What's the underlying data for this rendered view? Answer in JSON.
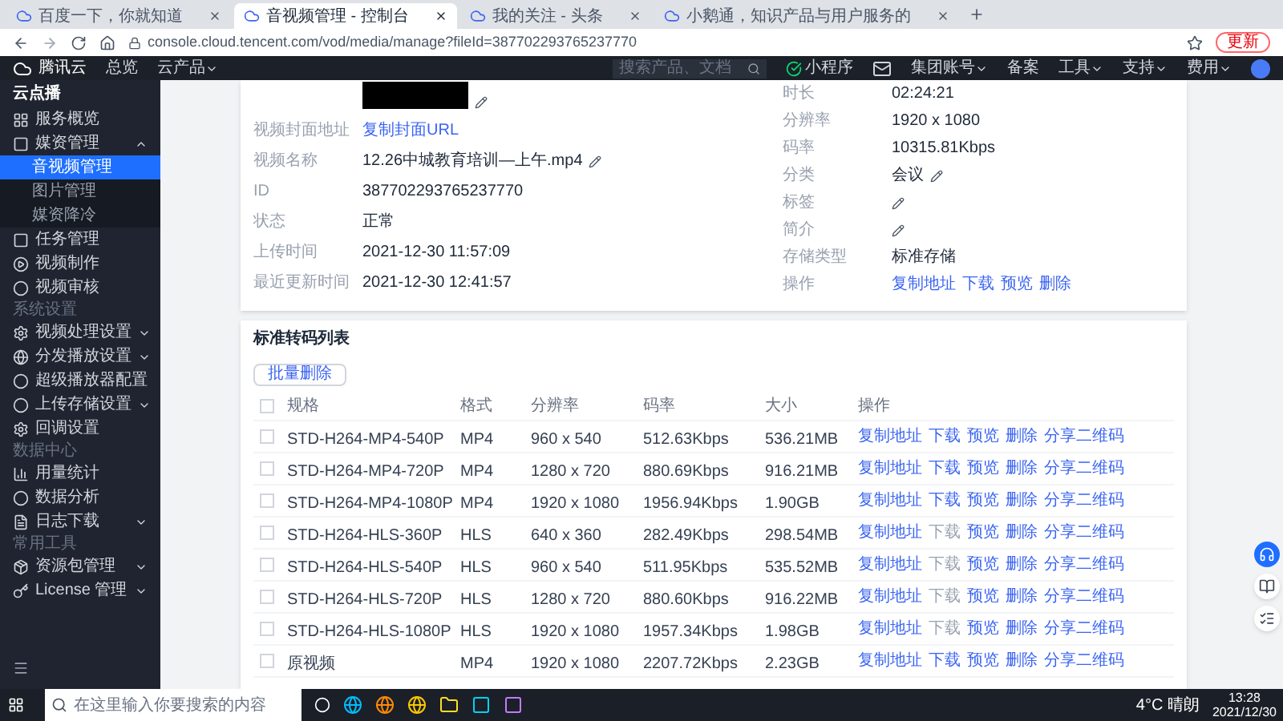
{
  "browser": {
    "tabs": [
      {
        "title": "百度一下，你就知道",
        "selected": false
      },
      {
        "title": "音视频管理 - 控制台",
        "selected": true
      },
      {
        "title": "我的关注 - 头条",
        "selected": false
      },
      {
        "title": "小鹅通，知识产品与用户服务的",
        "selected": false
      }
    ],
    "url": "console.cloud.tencent.com/vod/media/manage?fileId=387702293765237770",
    "update_button": "更新"
  },
  "topnav": {
    "logo": "腾讯云",
    "left": [
      {
        "label": "总览",
        "dropdown": false
      },
      {
        "label": "云产品",
        "dropdown": true
      }
    ],
    "search_placeholder": "搜索产品、文档",
    "right": [
      {
        "label": "小程序",
        "kind": "mini"
      },
      {
        "kind": "mail"
      },
      {
        "label": "集团账号",
        "kind": "menu"
      },
      {
        "label": "备案",
        "kind": "link"
      },
      {
        "label": "工具",
        "kind": "menu"
      },
      {
        "label": "支持",
        "kind": "menu"
      },
      {
        "label": "费用",
        "kind": "menu"
      }
    ]
  },
  "sidebar": {
    "title": "云点播",
    "groups": [
      {
        "items": [
          {
            "label": "服务概览"
          },
          {
            "label": "媒资管理",
            "expanded": true,
            "children": [
              {
                "label": "音视频管理",
                "selected": true
              },
              {
                "label": "图片管理",
                "selected": false
              },
              {
                "label": "媒资降冷",
                "selected": false
              }
            ]
          },
          {
            "label": "任务管理"
          },
          {
            "label": "视频制作"
          },
          {
            "label": "视频审核"
          }
        ]
      },
      {
        "heading": "系统设置",
        "items": [
          {
            "label": "视频处理设置",
            "expanded": false
          },
          {
            "label": "分发播放设置",
            "expanded": false
          },
          {
            "label": "超级播放器配置"
          },
          {
            "label": "上传存储设置",
            "expanded": false
          },
          {
            "label": "回调设置"
          }
        ]
      },
      {
        "heading": "数据中心",
        "items": [
          {
            "label": "用量统计"
          },
          {
            "label": "数据分析"
          },
          {
            "label": "日志下载",
            "expanded": false
          }
        ]
      },
      {
        "heading": "常用工具",
        "items": [
          {
            "label": "资源包管理",
            "expanded": false
          },
          {
            "label": "License 管理",
            "expanded": false
          }
        ]
      }
    ]
  },
  "details": {
    "left": [
      {
        "label": "视频封面地址",
        "value": "复制封面URL",
        "kind": "link"
      },
      {
        "label": "视频名称",
        "value": "12.26中城教育培训—上午.mp4",
        "kind": "editable"
      },
      {
        "label": "ID",
        "value": "387702293765237770",
        "kind": "text"
      },
      {
        "label": "状态",
        "value": "正常",
        "kind": "text"
      },
      {
        "label": "上传时间",
        "value": "2021-12-30 11:57:09",
        "kind": "text"
      },
      {
        "label": "最近更新时间",
        "value": "2021-12-30 12:41:57",
        "kind": "text"
      }
    ],
    "right": [
      {
        "label": "时长",
        "value": "02:24:21",
        "kind": "text"
      },
      {
        "label": "分辨率",
        "value": "1920 x 1080",
        "kind": "text"
      },
      {
        "label": "码率",
        "value": "10315.81Kbps",
        "kind": "text"
      },
      {
        "label": "分类",
        "value": "会议",
        "kind": "editable"
      },
      {
        "label": "标签",
        "kind": "editable"
      },
      {
        "label": "简介",
        "kind": "editable"
      },
      {
        "label": "存储类型",
        "value": "标准存储",
        "kind": "text"
      },
      {
        "label": "操作",
        "kind": "links",
        "links": [
          "复制地址",
          "下载",
          "预览",
          "删除"
        ]
      }
    ]
  },
  "transcode": {
    "title": "标准转码列表",
    "batch_button": "批量删除",
    "all_checked": false,
    "columns": [
      "规格",
      "格式",
      "分辨率",
      "码率",
      "大小",
      "操作"
    ],
    "rows": [
      {
        "cells": [
          "STD-H264-MP4-540P",
          "MP4",
          "960 x 540",
          "512.63Kbps",
          "536.21MB"
        ],
        "checked": false,
        "actions": [
          {
            "label": "复制地址",
            "disabled": false
          },
          {
            "label": "下载",
            "disabled": false
          },
          {
            "label": "预览",
            "disabled": false
          },
          {
            "label": "删除",
            "disabled": false
          },
          {
            "label": "分享二维码",
            "disabled": false
          }
        ]
      },
      {
        "cells": [
          "STD-H264-MP4-720P",
          "MP4",
          "1280 x 720",
          "880.69Kbps",
          "916.21MB"
        ],
        "checked": false,
        "actions": [
          {
            "label": "复制地址",
            "disabled": false
          },
          {
            "label": "下载",
            "disabled": false
          },
          {
            "label": "预览",
            "disabled": false
          },
          {
            "label": "删除",
            "disabled": false
          },
          {
            "label": "分享二维码",
            "disabled": false
          }
        ]
      },
      {
        "cells": [
          "STD-H264-MP4-1080P",
          "MP4",
          "1920 x 1080",
          "1956.94Kbps",
          "1.90GB"
        ],
        "checked": false,
        "actions": [
          {
            "label": "复制地址",
            "disabled": false
          },
          {
            "label": "下载",
            "disabled": false
          },
          {
            "label": "预览",
            "disabled": false
          },
          {
            "label": "删除",
            "disabled": false
          },
          {
            "label": "分享二维码",
            "disabled": false
          }
        ]
      },
      {
        "cells": [
          "STD-H264-HLS-360P",
          "HLS",
          "640 x 360",
          "282.49Kbps",
          "298.54MB"
        ],
        "checked": false,
        "actions": [
          {
            "label": "复制地址",
            "disabled": false
          },
          {
            "label": "下载",
            "disabled": true
          },
          {
            "label": "预览",
            "disabled": false
          },
          {
            "label": "删除",
            "disabled": false
          },
          {
            "label": "分享二维码",
            "disabled": false
          }
        ]
      },
      {
        "cells": [
          "STD-H264-HLS-540P",
          "HLS",
          "960 x 540",
          "511.95Kbps",
          "535.52MB"
        ],
        "checked": false,
        "actions": [
          {
            "label": "复制地址",
            "disabled": false
          },
          {
            "label": "下载",
            "disabled": true
          },
          {
            "label": "预览",
            "disabled": false
          },
          {
            "label": "删除",
            "disabled": false
          },
          {
            "label": "分享二维码",
            "disabled": false
          }
        ]
      },
      {
        "cells": [
          "STD-H264-HLS-720P",
          "HLS",
          "1280 x 720",
          "880.60Kbps",
          "916.22MB"
        ],
        "checked": false,
        "actions": [
          {
            "label": "复制地址",
            "disabled": false
          },
          {
            "label": "下载",
            "disabled": true
          },
          {
            "label": "预览",
            "disabled": false
          },
          {
            "label": "删除",
            "disabled": false
          },
          {
            "label": "分享二维码",
            "disabled": false
          }
        ]
      },
      {
        "cells": [
          "STD-H264-HLS-1080P",
          "HLS",
          "1920 x 1080",
          "1957.34Kbps",
          "1.98GB"
        ],
        "checked": false,
        "actions": [
          {
            "label": "复制地址",
            "disabled": false
          },
          {
            "label": "下载",
            "disabled": true
          },
          {
            "label": "预览",
            "disabled": false
          },
          {
            "label": "删除",
            "disabled": false
          },
          {
            "label": "分享二维码",
            "disabled": false
          }
        ]
      },
      {
        "cells": [
          "原视频",
          "MP4",
          "1920 x 1080",
          "2207.72Kbps",
          "2.23GB"
        ],
        "checked": false,
        "actions": [
          {
            "label": "复制地址",
            "disabled": false
          },
          {
            "label": "下载",
            "disabled": false
          },
          {
            "label": "预览",
            "disabled": false
          },
          {
            "label": "删除",
            "disabled": false
          },
          {
            "label": "分享二维码",
            "disabled": false
          }
        ]
      }
    ]
  },
  "taskbar": {
    "search_placeholder": "在这里输入你要搜索的内容",
    "weather": "4°C 晴朗",
    "time": "13:28",
    "date": "2021/12/30"
  }
}
